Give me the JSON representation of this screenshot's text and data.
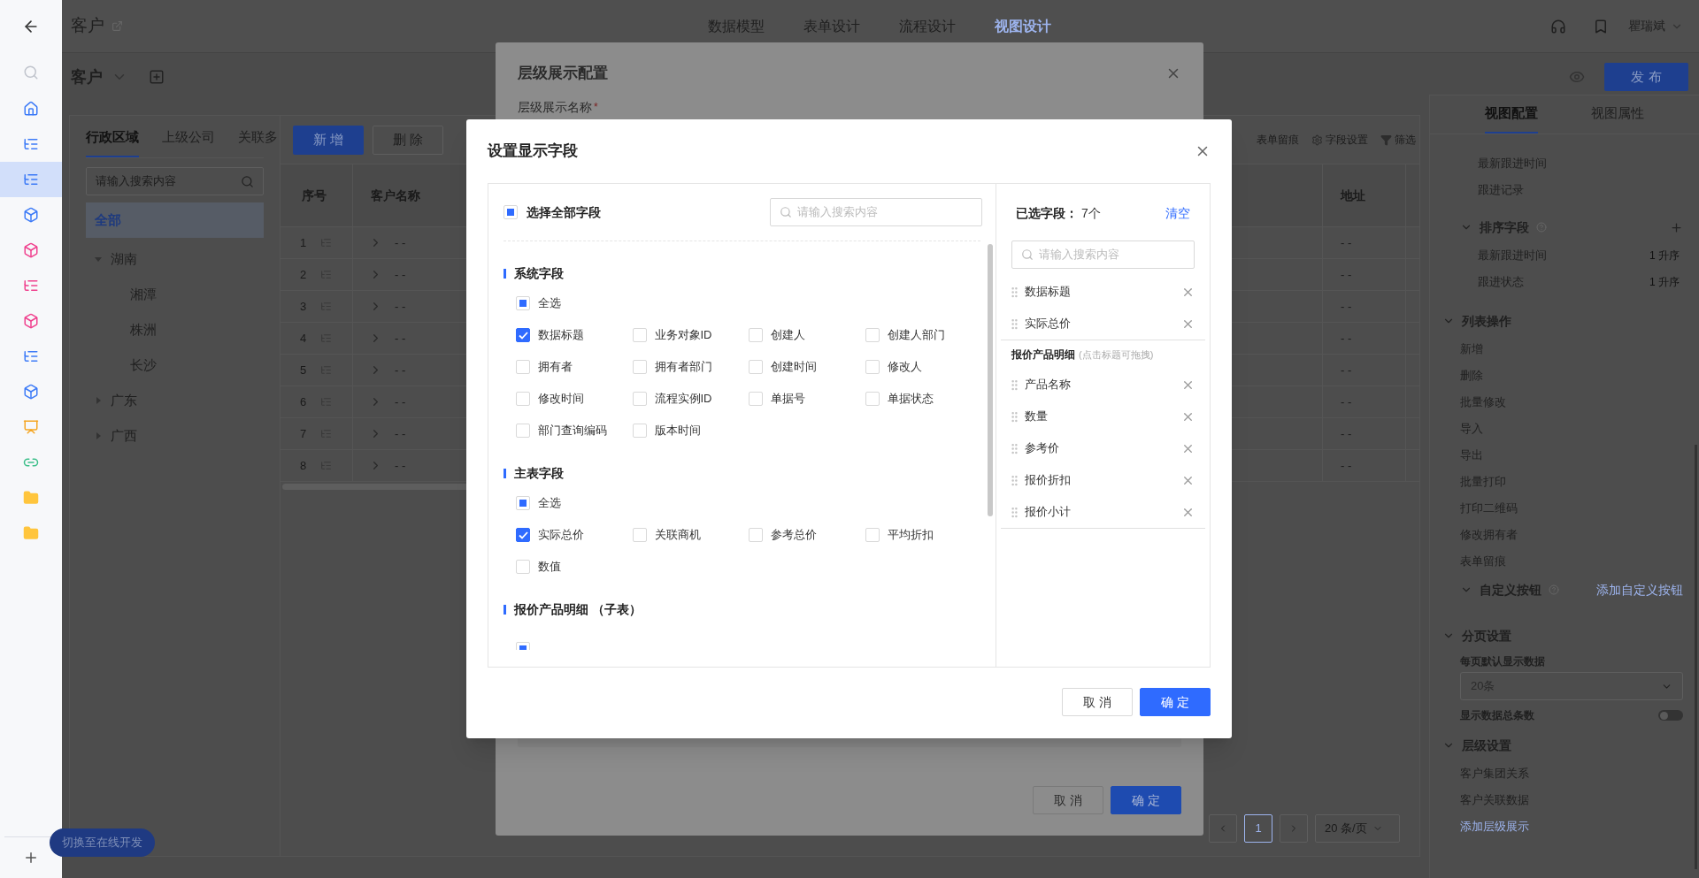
{
  "sidebar": {
    "items": [
      {
        "kind": "home",
        "color": "#3d7bf7",
        "selected": false
      },
      {
        "kind": "tree",
        "color": "#3d7bf7",
        "selected": false
      },
      {
        "kind": "tree",
        "color": "#3d7bf7",
        "selected": true
      },
      {
        "kind": "cube",
        "color": "#3d7bf7",
        "selected": false
      },
      {
        "kind": "cube",
        "color": "#f0418e",
        "selected": false
      },
      {
        "kind": "tree",
        "color": "#f0418e",
        "selected": false
      },
      {
        "kind": "cube",
        "color": "#f0418e",
        "selected": false
      },
      {
        "kind": "tree",
        "color": "#3d7bf7",
        "selected": false
      },
      {
        "kind": "cube",
        "color": "#3d7bf7",
        "selected": false
      },
      {
        "kind": "screen",
        "color": "#f5a623",
        "selected": false
      },
      {
        "kind": "link",
        "color": "#3dbf8a",
        "selected": false
      },
      {
        "kind": "folder",
        "color": "#ffc53d",
        "selected": false
      },
      {
        "kind": "folder",
        "color": "#ffc53d",
        "selected": false
      }
    ]
  },
  "header": {
    "title": "客户",
    "tabs": [
      {
        "label": "数据模型",
        "selected": false
      },
      {
        "label": "表单设计",
        "selected": false
      },
      {
        "label": "流程设计",
        "selected": false
      },
      {
        "label": "视图设计",
        "selected": true
      }
    ],
    "user": "瞿瑞斌"
  },
  "toolbar": {
    "view_name": "客户",
    "publish": "发 布"
  },
  "left_panel": {
    "tabs": [
      {
        "label": "行政区域",
        "selected": true
      },
      {
        "label": "上级公司",
        "selected": false
      },
      {
        "label": "关联多",
        "selected": false
      }
    ],
    "search": {
      "placeholder": "请输入搜索内容"
    },
    "tree": [
      {
        "label": "全部",
        "selected": true,
        "expanded": false
      },
      {
        "label": "湖南",
        "selected": false,
        "expanded": true,
        "children": [
          {
            "label": "湘潭",
            "selected": false
          },
          {
            "label": "株洲",
            "selected": false
          },
          {
            "label": "长沙",
            "selected": false
          }
        ]
      },
      {
        "label": "广东",
        "selected": false,
        "expanded": false
      },
      {
        "label": "广西",
        "selected": false,
        "expanded": false
      }
    ]
  },
  "table": {
    "buttons": [
      {
        "label": "新 增",
        "kind": "primary"
      },
      {
        "label": "删 除",
        "kind": "default"
      }
    ],
    "tools": [
      {
        "label": "表单留痕",
        "kind": "none"
      },
      {
        "label": "字段设置",
        "kind": "gear"
      },
      {
        "label": "筛选",
        "kind": "filter"
      }
    ],
    "columns": [
      "序号",
      "客户名称",
      "地址"
    ],
    "rows": [
      {
        "index": "1",
        "name": "- -",
        "address": "- -"
      },
      {
        "index": "2",
        "name": "- -",
        "address": "- -"
      },
      {
        "index": "3",
        "name": "- -",
        "address": "- -"
      },
      {
        "index": "4",
        "name": "- -",
        "address": "- -"
      },
      {
        "index": "5",
        "name": "- -",
        "address": "- -"
      },
      {
        "index": "6",
        "name": "- -",
        "address": "- -"
      },
      {
        "index": "7",
        "name": "- -",
        "address": "- -"
      },
      {
        "index": "8",
        "name": "- -",
        "address": "- -"
      }
    ],
    "pagination": {
      "page": "1",
      "page_size": "20 条/页"
    }
  },
  "right_panel": {
    "tabs": [
      {
        "label": "视图配置",
        "selected": true
      },
      {
        "label": "视图属性",
        "selected": false
      }
    ],
    "fields": [
      "最新跟进时间",
      "跟进记录"
    ],
    "sort": {
      "title": "排序字段",
      "items": [
        {
          "name": "最新跟进时间",
          "order": "1 升序"
        },
        {
          "name": "跟进状态",
          "order": "1 升序"
        }
      ]
    },
    "list_ops": {
      "title": "列表操作",
      "items": [
        "新增",
        "删除",
        "批量修改",
        "导入",
        "导出",
        "批量打印",
        "打印二维码",
        "修改拥有者",
        "表单留痕"
      ]
    },
    "custom": {
      "title": "自定义按钮",
      "link": "添加自定义按钮"
    },
    "paging": {
      "title": "分页设置",
      "label": "每页默认显示数据",
      "value": "20条",
      "total_label": "显示数据总条数",
      "total_on": false
    },
    "levels": {
      "title": "层级设置",
      "items": [
        "客户集团关系",
        "客户关联数据"
      ],
      "link": "添加层级展示"
    }
  },
  "switch_button": "切换至在线开发",
  "hierarchy_modal": {
    "title": "层级展示配置",
    "field_label": "层级展示名称",
    "required_mark": "*",
    "buttons": [
      {
        "label": "取 消",
        "kind": "default"
      },
      {
        "label": "确 定",
        "kind": "primary"
      }
    ]
  },
  "fields_modal": {
    "title": "设置显示字段",
    "select_all": {
      "label": "选择全部字段",
      "indeterminate": true
    },
    "search": {
      "placeholder": "请输入搜索内容"
    },
    "groups": [
      {
        "title": "系统字段",
        "select_all": {
          "label": "全选",
          "indeterminate": true
        },
        "fields": [
          {
            "label": "数据标题",
            "checked": true
          },
          {
            "label": "业务对象ID",
            "checked": false
          },
          {
            "label": "创建人",
            "checked": false
          },
          {
            "label": "创建人部门",
            "checked": false
          },
          {
            "label": "拥有者",
            "checked": false
          },
          {
            "label": "拥有者部门",
            "checked": false
          },
          {
            "label": "创建时间",
            "checked": false
          },
          {
            "label": "修改人",
            "checked": false
          },
          {
            "label": "修改时间",
            "checked": false
          },
          {
            "label": "流程实例ID",
            "checked": false
          },
          {
            "label": "单据号",
            "checked": false
          },
          {
            "label": "单据状态",
            "checked": false
          },
          {
            "label": "部门查询编码",
            "checked": false
          },
          {
            "label": "版本时间",
            "checked": false
          }
        ]
      },
      {
        "title": "主表字段",
        "select_all": {
          "label": "全选",
          "indeterminate": true
        },
        "fields": [
          {
            "label": "实际总价",
            "checked": true
          },
          {
            "label": "关联商机",
            "checked": false
          },
          {
            "label": "参考总价",
            "checked": false
          },
          {
            "label": "平均折扣",
            "checked": false
          },
          {
            "label": "数值",
            "checked": false
          }
        ]
      },
      {
        "title": "报价产品明细 （子表）",
        "select_all": {
          "indeterminate": true
        }
      }
    ],
    "selected": {
      "title": "已选字段：",
      "count": "7个",
      "clear": "清空",
      "search": {
        "placeholder": "请输入搜索内容"
      },
      "groups": [
        {
          "items": [
            "数据标题",
            "实际总价"
          ]
        },
        {
          "title": "报价产品明细",
          "hint": "(点击标题可拖拽)",
          "items": [
            "产品名称",
            "数量",
            "参考价",
            "报价折扣",
            "报价小计"
          ]
        }
      ]
    },
    "buttons": [
      {
        "label": "取 消",
        "kind": "default"
      },
      {
        "label": "确 定",
        "kind": "primary"
      }
    ]
  }
}
